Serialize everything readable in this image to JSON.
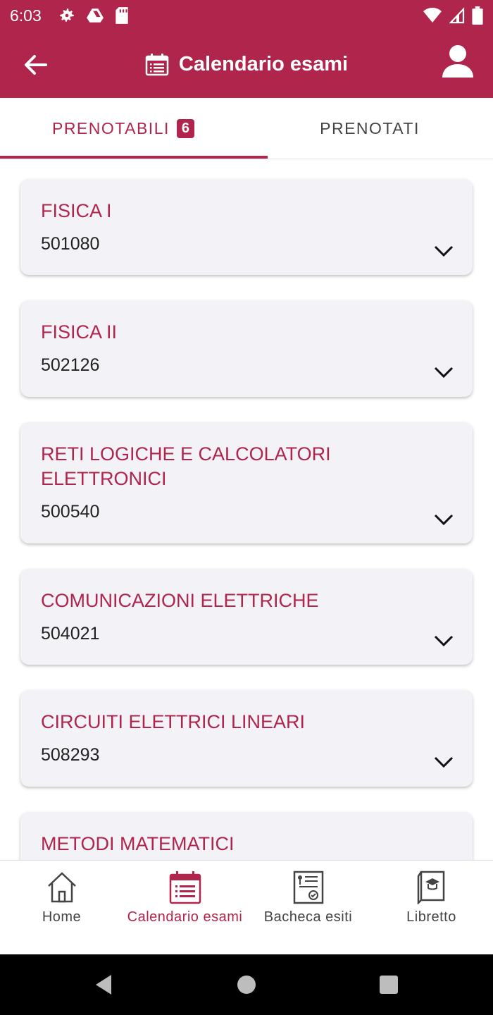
{
  "status_bar": {
    "time": "6:03",
    "left_icons": [
      "gear-icon",
      "drive-icon",
      "sd-card-icon"
    ],
    "right_icons": [
      "wifi-icon",
      "signal-icon",
      "battery-icon"
    ]
  },
  "app_bar": {
    "title": "Calendario esami",
    "title_icon": "calendar-icon",
    "back_icon": "arrow-left-icon",
    "profile_icon": "person-icon",
    "color": "#b0254b"
  },
  "tabs": [
    {
      "label": "PRENOTABILI",
      "badge": "6",
      "active": true
    },
    {
      "label": "PRENOTATI",
      "active": false
    }
  ],
  "exams": [
    {
      "title": "FISICA I",
      "code": "501080"
    },
    {
      "title": "FISICA II",
      "code": "502126"
    },
    {
      "title": "RETI LOGICHE E CALCOLATORI ELETTRONICI",
      "code": "500540"
    },
    {
      "title": "COMUNICAZIONI ELETTRICHE",
      "code": "504021"
    },
    {
      "title": "CIRCUITI ELETTRICI LINEARI",
      "code": "508293"
    },
    {
      "title": "METODI MATEMATICI",
      "code": ""
    }
  ],
  "bottom_nav": [
    {
      "label": "Home",
      "icon": "home-icon",
      "active": false
    },
    {
      "label": "Calendario esami",
      "icon": "calendar-icon",
      "active": true
    },
    {
      "label": "Bacheca esiti",
      "icon": "results-board-icon",
      "active": false
    },
    {
      "label": "Libretto",
      "icon": "booklet-icon",
      "active": false
    }
  ],
  "system_nav": [
    "back-triangle-icon",
    "home-circle-icon",
    "recents-square-icon"
  ]
}
